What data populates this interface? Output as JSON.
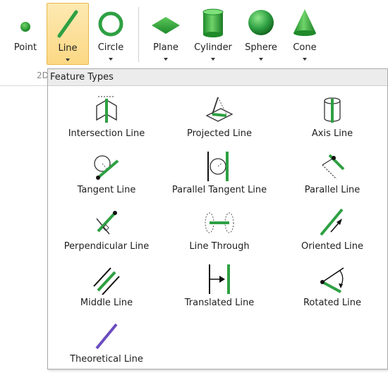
{
  "colors": {
    "accent_green": "#2ea043",
    "active_bg": "#fbd884",
    "theoretical_purple": "#6a4cc0"
  },
  "toolbar": {
    "buttons": [
      {
        "label": "Point",
        "icon": "point-icon",
        "active": false,
        "has_dropdown": false
      },
      {
        "label": "Line",
        "icon": "line-icon",
        "active": true,
        "has_dropdown": true
      },
      {
        "label": "Circle",
        "icon": "circle-icon",
        "active": false,
        "has_dropdown": true
      },
      {
        "label": "Plane",
        "icon": "plane-icon",
        "active": false,
        "has_dropdown": true
      },
      {
        "label": "Cylinder",
        "icon": "cylinder-icon",
        "active": false,
        "has_dropdown": true
      },
      {
        "label": "Sphere",
        "icon": "sphere-icon",
        "active": false,
        "has_dropdown": true
      },
      {
        "label": "Cone",
        "icon": "cone-icon",
        "active": false,
        "has_dropdown": true
      }
    ],
    "group_tab": "2D"
  },
  "dropdown": {
    "title": "Feature Types",
    "items": [
      {
        "label": "Intersection Line",
        "icon": "intersection-line-icon"
      },
      {
        "label": "Projected Line",
        "icon": "projected-line-icon"
      },
      {
        "label": "Axis Line",
        "icon": "axis-line-icon"
      },
      {
        "label": "Tangent Line",
        "icon": "tangent-line-icon"
      },
      {
        "label": "Parallel Tangent Line",
        "icon": "parallel-tangent-line-icon"
      },
      {
        "label": "Parallel Line",
        "icon": "parallel-line-icon"
      },
      {
        "label": "Perpendicular Line",
        "icon": "perpendicular-line-icon"
      },
      {
        "label": "Line Through",
        "icon": "line-through-icon"
      },
      {
        "label": "Oriented Line",
        "icon": "oriented-line-icon"
      },
      {
        "label": "Middle Line",
        "icon": "middle-line-icon"
      },
      {
        "label": "Translated Line",
        "icon": "translated-line-icon"
      },
      {
        "label": "Rotated Line",
        "icon": "rotated-line-icon"
      },
      {
        "label": "Theoretical Line",
        "icon": "theoretical-line-icon"
      }
    ]
  }
}
